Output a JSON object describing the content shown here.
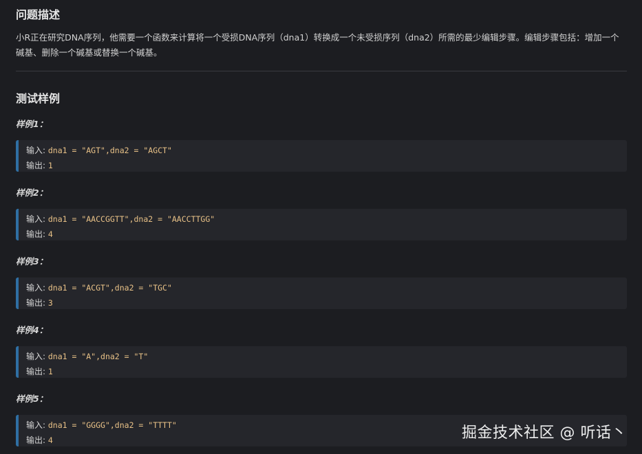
{
  "description": {
    "title": "问题描述",
    "text": "小R正在研究DNA序列，他需要一个函数来计算将一个受损DNA序列（dna1）转换成一个未受损序列（dna2）所需的最少编辑步骤。编辑步骤包括：增加一个碱基、删除一个碱基或替换一个碱基。"
  },
  "tests": {
    "title": "测试样例",
    "input_label": "输入:",
    "output_label": "输出:",
    "cases": [
      {
        "title": "样例1：",
        "input": "dna1 = \"AGT\",dna2 = \"AGCT\"",
        "output": "1"
      },
      {
        "title": "样例2：",
        "input": "dna1 = \"AACCGGTT\",dna2 = \"AACCTTGG\"",
        "output": "4"
      },
      {
        "title": "样例3：",
        "input": "dna1 = \"ACGT\",dna2 = \"TGC\"",
        "output": "3"
      },
      {
        "title": "样例4：",
        "input": "dna1 = \"A\",dna2 = \"T\"",
        "output": "1"
      },
      {
        "title": "样例5：",
        "input": "dna1 = \"GGGG\",dna2 = \"TTTT\"",
        "output": "4"
      }
    ]
  },
  "watermark": "掘金技术社区 @ 听话丶"
}
